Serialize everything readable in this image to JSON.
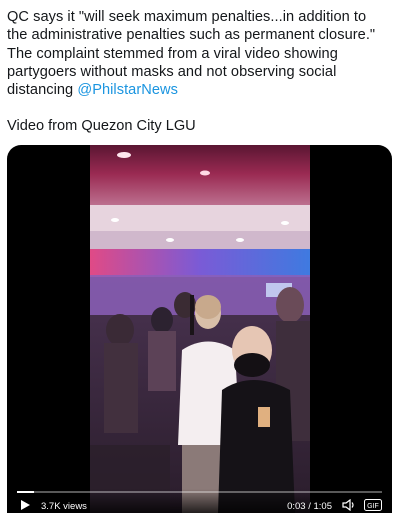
{
  "tweet": {
    "lines": [
      "QC says it \"will seek maximum penalties...in addition to",
      "the administrative penalties such as permanent closure.\"",
      "The complaint stemmed from a viral video showing",
      "partygoers without masks and not observing social"
    ],
    "last_line_prefix": "distancing",
    "mention": "@PhilstarNews",
    "mention_color": "#1b95e0"
  },
  "caption": "Video from Quezon City LGU",
  "video": {
    "views": "3.7K views",
    "time": "0:03 / 1:05",
    "progress": 0.046
  },
  "icons": {
    "play": "play-icon",
    "volume": "volume-icon",
    "gif": "gif-icon"
  }
}
